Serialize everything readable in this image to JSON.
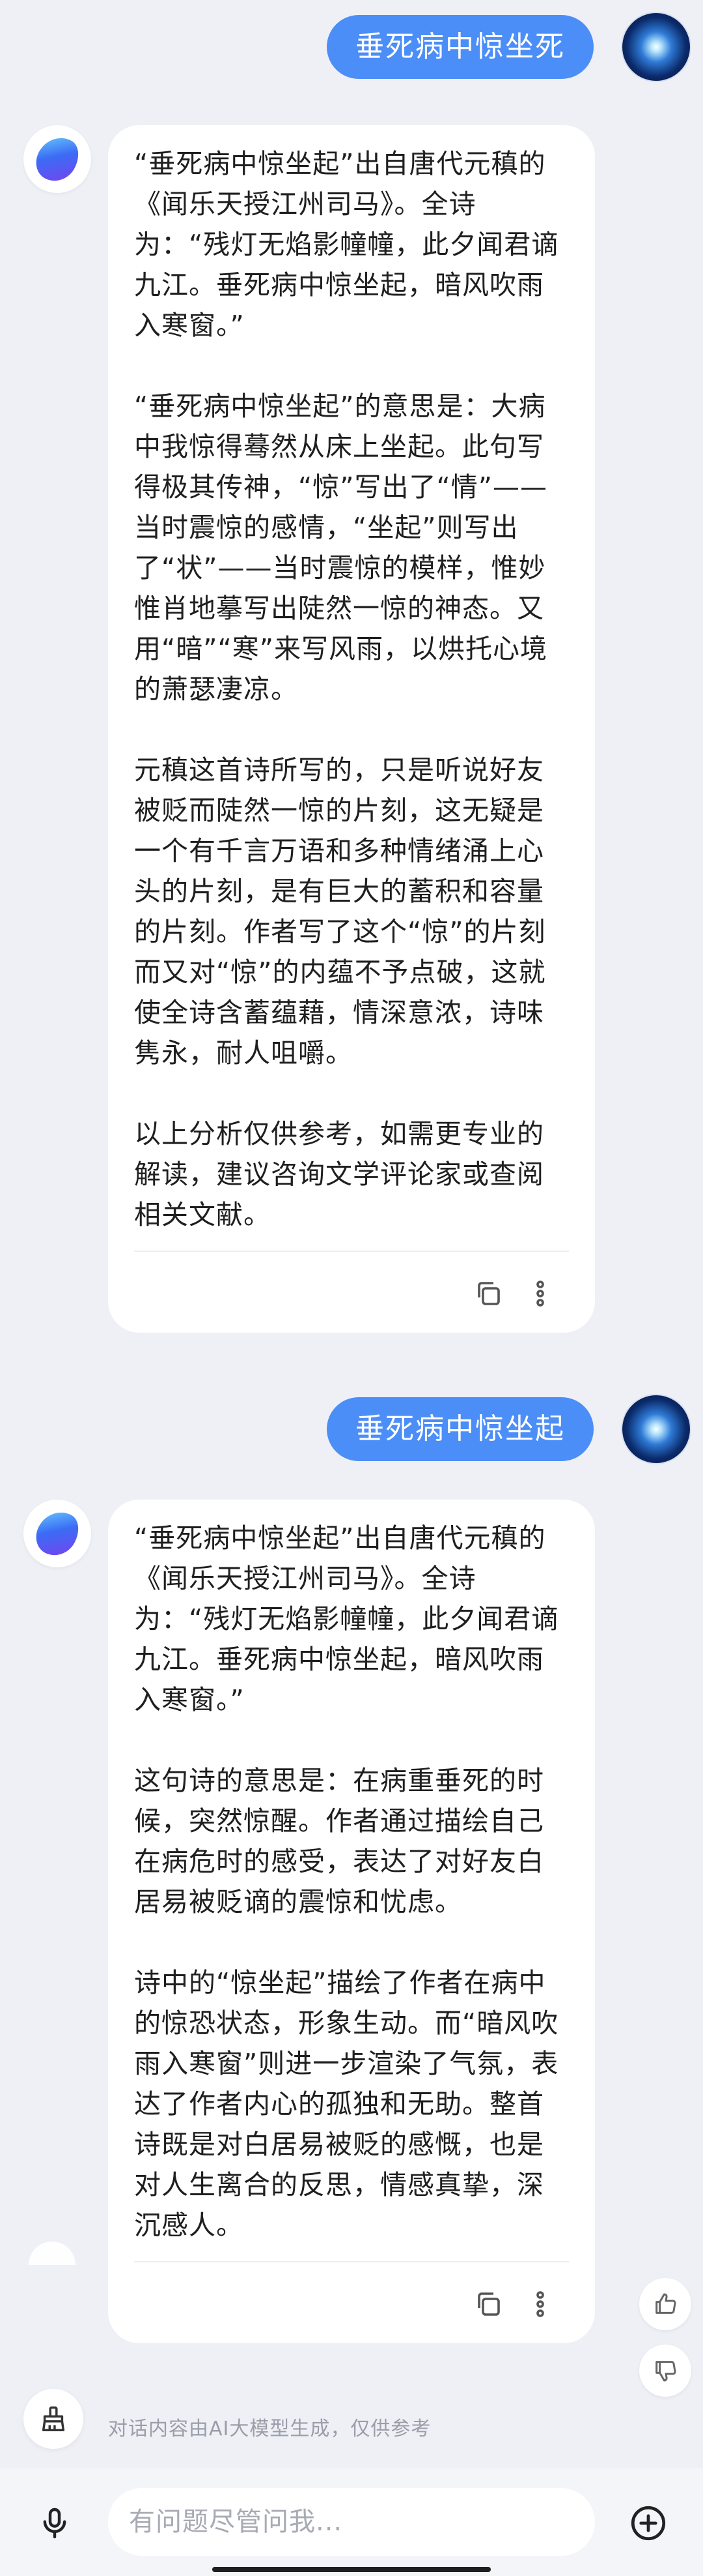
{
  "conversation": {
    "messages": [
      {
        "role": "user",
        "text": "垂死病中惊坐死"
      },
      {
        "role": "assistant",
        "paragraphs": [
          "“垂死病中惊坐起”出自唐代元稹的《闻乐天授江州司马》。全诗为：“残灯无焰影幢幢，此夕闻君谪九江。垂死病中惊坐起，暗风吹雨入寒窗。”",
          "“垂死病中惊坐起”的意思是：大病中我惊得蓦然从床上坐起。此句写得极其传神，“惊”写出了“情”——当时震惊的感情，“坐起”则写出了“状”——当时震惊的模样，惟妙惟肖地摹写出陡然一惊的神态。又用“暗”“寒”来写风雨，以烘托心境的萧瑟凄凉。",
          "元稹这首诗所写的，只是听说好友被贬而陡然一惊的片刻，这无疑是一个有千言万语和多种情绪涌上心头的片刻，是有巨大的蓄积和容量的片刻。作者写了这个“惊”的片刻而又对“惊”的内蕴不予点破，这就使全诗含蓄蕴藉，情深意浓，诗味隽永，耐人咀嚼。",
          "以上分析仅供参考，如需更专业的解读，建议咨询文学评论家或查阅相关文献。"
        ]
      },
      {
        "role": "user",
        "text": "垂死病中惊坐起"
      },
      {
        "role": "assistant",
        "paragraphs": [
          "“垂死病中惊坐起”出自唐代元稹的《闻乐天授江州司马》。全诗为：“残灯无焰影幢幢，此夕闻君谪九江。垂死病中惊坐起，暗风吹雨入寒窗。”",
          "这句诗的意思是：在病重垂死的时候，突然惊醒。作者通过描绘自己在病危时的感受，表达了对好友白居易被贬谪的震惊和忧虑。",
          "诗中的“惊坐起”描绘了作者在病中的惊恐状态，形象生动。而“暗风吹雨入寒窗”则进一步渲染了气氛，表达了作者内心的孤独和无助。整首诗既是对白居易被贬的感慨，也是对人生离合的反思，情感真挚，深沉感人。"
        ]
      }
    ]
  },
  "footer": {
    "disclaimer": "对话内容由AI大模型生成，仅供参考",
    "input_placeholder": "有问题尽管问我..."
  },
  "icons": {
    "copy": "copy-icon",
    "more": "more-vertical-icon",
    "like": "thumbs-up-icon",
    "dislike": "thumbs-down-icon",
    "clear": "broom-icon",
    "mic": "microphone-icon",
    "add": "plus-circle-icon"
  },
  "colors": {
    "background": "#eef0f6",
    "user_bubble": "#4c8ef7",
    "card": "#ffffff",
    "text": "#1f1f1f",
    "muted": "#9a9ea8"
  }
}
